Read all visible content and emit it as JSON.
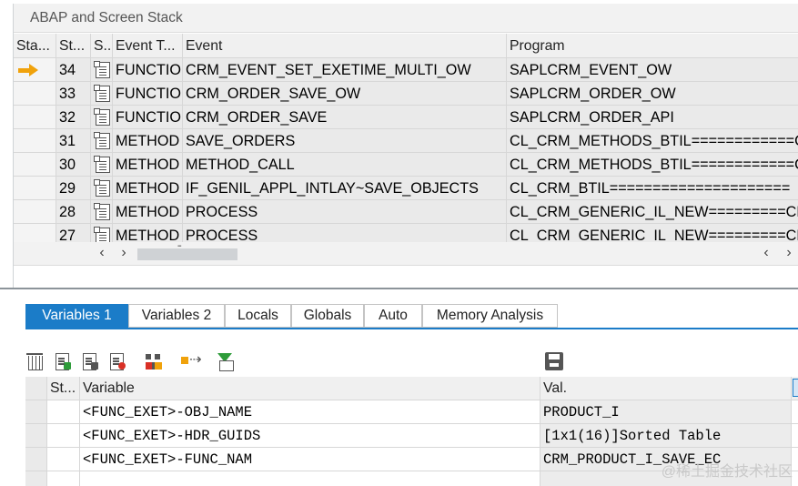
{
  "stack_panel": {
    "title": "ABAP and Screen Stack",
    "columns": [
      "Sta...",
      "St...",
      "S...",
      "Event T...",
      "Event",
      "Program"
    ],
    "rows": [
      {
        "level": "34",
        "event_type": "FUNCTIO...",
        "event": "CRM_EVENT_SET_EXETIME_MULTI_OW",
        "program": "SAPLCRM_EVENT_OW",
        "current": true
      },
      {
        "level": "33",
        "event_type": "FUNCTIO...",
        "event": "CRM_ORDER_SAVE_OW",
        "program": "SAPLCRM_ORDER_OW",
        "current": false
      },
      {
        "level": "32",
        "event_type": "FUNCTIO...",
        "event": "CRM_ORDER_SAVE",
        "program": "SAPLCRM_ORDER_API",
        "current": false
      },
      {
        "level": "31",
        "event_type": "METHOD",
        "event": "SAVE_ORDERS",
        "program": "CL_CRM_METHODS_BTIL============C",
        "current": false
      },
      {
        "level": "30",
        "event_type": "METHOD",
        "event": "METHOD_CALL",
        "program": "CL_CRM_METHODS_BTIL============C",
        "current": false
      },
      {
        "level": "29",
        "event_type": "METHOD",
        "event": "IF_GENIL_APPL_INTLAY~SAVE_OBJECTS",
        "program": "CL_CRM_BTIL=====================",
        "current": false
      },
      {
        "level": "28",
        "event_type": "METHOD",
        "event": "PROCESS",
        "program": "CL_CRM_GENERIC_IL_NEW=========CL",
        "current": false
      },
      {
        "level": "27",
        "event_type": "METHOD",
        "event": "PROCESS",
        "program": "CL_CRM_GENERIC_IL_NEW=========CL",
        "current": false
      }
    ],
    "scroll": {
      "left": "‹",
      "right": "›"
    }
  },
  "tabs": [
    {
      "label": "Variables 1",
      "active": true
    },
    {
      "label": "Variables 2",
      "active": false
    },
    {
      "label": "Locals",
      "active": false
    },
    {
      "label": "Globals",
      "active": false
    },
    {
      "label": "Auto",
      "active": false
    },
    {
      "label": "Memory Analysis",
      "active": false
    }
  ],
  "toolbar_icons": [
    "delete-icon",
    "insert-variable-icon",
    "insert-variable-alt-icon",
    "delete-variable-icon",
    "stack-icon",
    "move-icon",
    "filter-icon",
    "save-icon"
  ],
  "variables": {
    "columns": [
      "",
      "St...",
      "Variable",
      "Val."
    ],
    "rows": [
      {
        "variable": "<FUNC_EXET>-OBJ_NAME",
        "value": "PRODUCT_I"
      },
      {
        "variable": "<FUNC_EXET>-HDR_GUIDS",
        "value": "[1x1(16)]Sorted Table"
      },
      {
        "variable": "<FUNC_EXET>-FUNC_NAM",
        "value": "CRM_PRODUCT_I_SAVE_EC"
      }
    ]
  },
  "watermark": "@稀土掘金技术社区",
  "colors": {
    "accent": "#1b7cc8",
    "current_arrow": "#f0a20b",
    "row_bg": "#eaeaea"
  }
}
